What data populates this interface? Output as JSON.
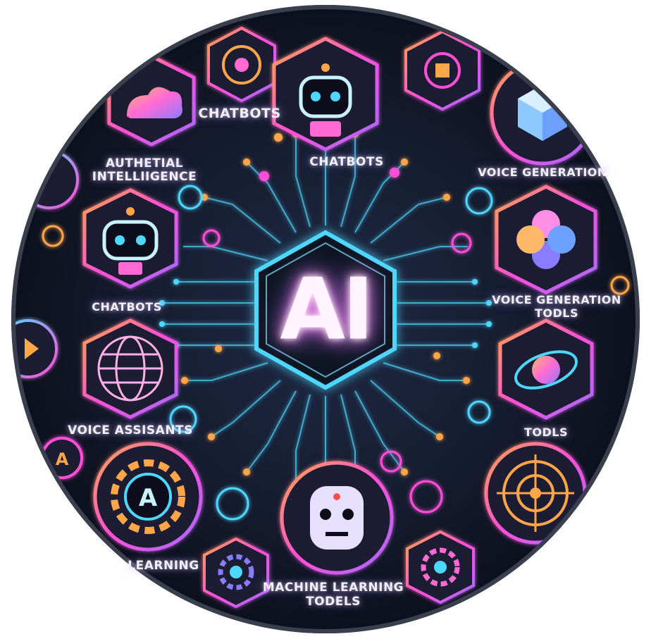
{
  "center": {
    "logo_text": "AI"
  },
  "labels": {
    "chatbots_top_left": "CHATBOTS",
    "chatbots_top_center": "CHATBOTS",
    "artificial_intelligence_line1": "AUTHETIAL",
    "artificial_intelligence_line2": "INTELLIIGENCE",
    "voice_generation": "VOICE GENERATION",
    "chatbots_left": "CHATBOTS",
    "voice_generation_tools_line1": "VOICE GENERATION",
    "voice_generation_tools_line2": "TODLS",
    "voice_assistants": "VOICE ASSISANTS",
    "tools_right": "TODLS",
    "learning_bottom_left": "LEARNING",
    "machine_learning_line1": "MACHINE LEARNING",
    "machine_learning_line2": "TODELS"
  },
  "colors": {
    "background": "#141a2b",
    "cyan": "#4fd8ff",
    "magenta": "#ff4fd8",
    "orange": "#ffa64a",
    "violet": "#a46bff"
  },
  "icons": [
    "robot-icon",
    "cloud-icon",
    "globe-icon",
    "gear-icon",
    "cube-icon",
    "flower-icon",
    "orbit-icon",
    "target-icon",
    "humanoid-icon"
  ]
}
